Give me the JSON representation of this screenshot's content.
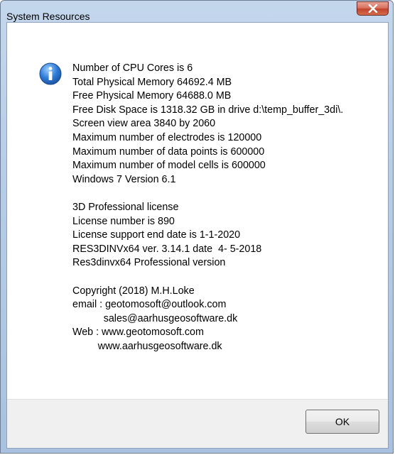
{
  "window": {
    "title": "System Resources",
    "close_symbol": "X"
  },
  "icon": "info-icon",
  "message": {
    "system": [
      "Number of CPU Cores is 6",
      "Total Physical Memory 64692.4 MB",
      "Free Physical Memory 64688.0 MB",
      "Free Disk Space is 1318.32 GB in drive d:\\temp_buffer_3di\\.",
      "Screen view area 3840 by 2060",
      "Maximum number of electrodes is 120000",
      "Maximum number of data points is 600000",
      "Maximum number of model cells is 600000",
      "Windows 7 Version 6.1"
    ],
    "license": [
      "3D Professional license",
      "License number is 890",
      "License support end date is 1-1-2020",
      "RES3DINVx64 ver. 3.14.1 date  4- 5-2018",
      "Res3dinvx64 Professional version"
    ],
    "copyright": [
      "Copyright (2018) M.H.Loke",
      "email : geotomosoft@outlook.com",
      "           sales@aarhusgeosoftware.dk",
      "Web : www.geotomosoft.com",
      "         www.aarhusgeosoftware.dk"
    ]
  },
  "buttons": {
    "ok_label": "OK"
  },
  "colors": {
    "title_bar": "#b9cfe7",
    "close_button": "#c7462c",
    "info_icon": "#2f6fc0",
    "footer": "#f0f0f0"
  }
}
